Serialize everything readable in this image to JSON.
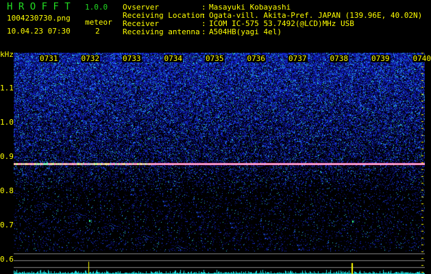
{
  "app": {
    "title": "H R O F F T",
    "version": "1.0.0",
    "filename": "1004230730.png",
    "datetime": "10.04.23 07:30",
    "meteor_label": "meteor",
    "meteor_count": "2"
  },
  "info": [
    {
      "label": "Ovserver",
      "value": "Masayuki Kobayashi"
    },
    {
      "label": "Receiving Location",
      "value": "Ogata-vill. Akita-Pref. JAPAN (139.96E, 40.02N)"
    },
    {
      "label": "Receiver",
      "value": "ICOM IC-575 53.7492(@LCD)MHz USB"
    },
    {
      "label": "Receiving antenna",
      "value": "A504HB(yagi 4el)"
    }
  ],
  "spectrogram": {
    "y_unit": "kHz",
    "y_ticks": [
      "1.1",
      "1.0",
      "0.9",
      "0.8",
      "0.7",
      "0.6"
    ],
    "time_ticks": [
      "0731",
      "0732",
      "0733",
      "0734",
      "0735",
      "0736",
      "0737",
      "0738",
      "0739",
      "0740"
    ],
    "carrier_khz": 0.88,
    "meteor_times": [
      "0731.5",
      "0737.9"
    ]
  }
}
